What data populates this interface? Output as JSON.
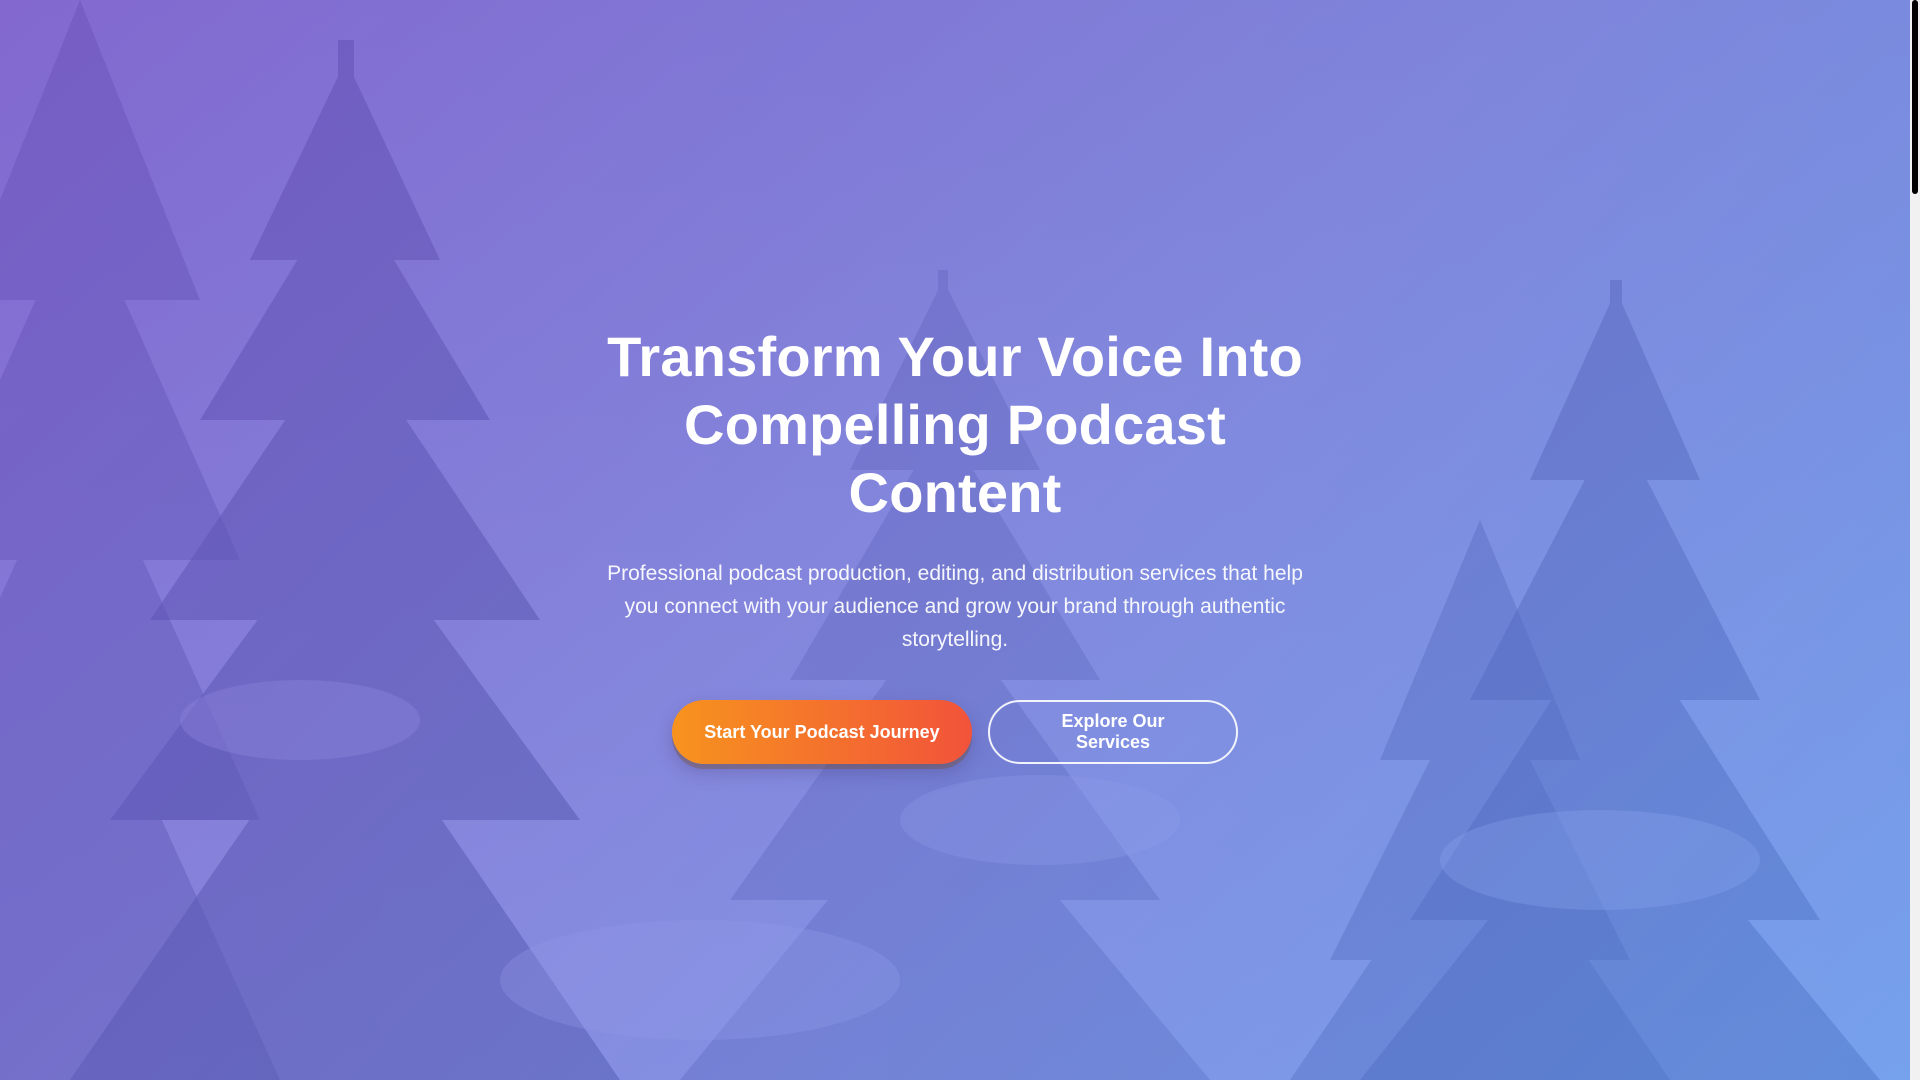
{
  "hero": {
    "title": "Transform Your Voice Into Compelling Podcast Content",
    "subtitle": "Professional podcast production, editing, and distribution services that help you connect with your audience and grow your brand through authentic storytelling.",
    "primary_cta": "Start Your Podcast Journey",
    "secondary_cta": "Explore Our Services"
  },
  "colors": {
    "overlay_start": "#7654cd",
    "overlay_end": "#548cee",
    "primary_cta_start": "#f7931e",
    "primary_cta_end": "#f2533a"
  }
}
